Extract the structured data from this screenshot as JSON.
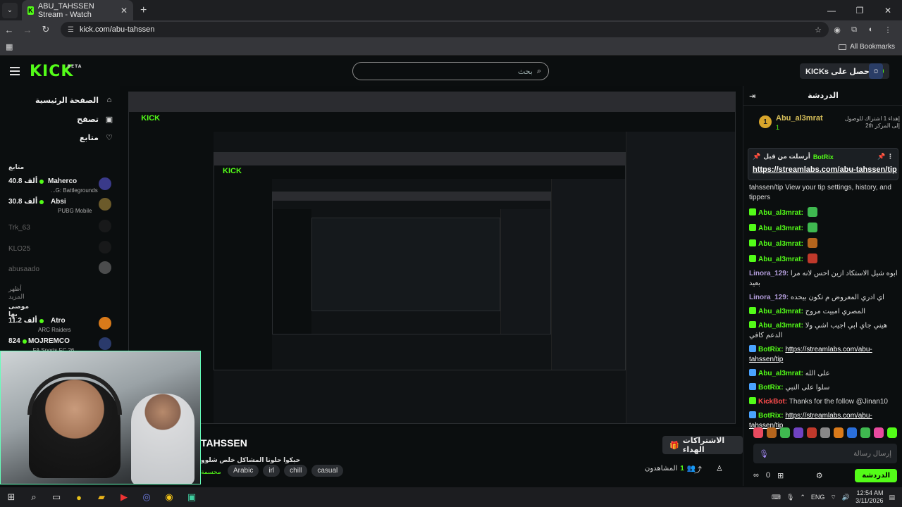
{
  "browser": {
    "tab_title": "ABU_TAHSSEN Stream - Watch",
    "url": "kick.com/abu-tahssen",
    "bookmarks_label": "All Bookmarks"
  },
  "header": {
    "logo": "KICK",
    "logo_sup": "BETA",
    "search_placeholder": "بحث",
    "get_kicks": "احصل على KICKs"
  },
  "sidebar": {
    "nav": [
      {
        "label": "الصفحة الرئيسية",
        "icon": "home-icon",
        "glyph": "⌂"
      },
      {
        "label": "تصفح",
        "icon": "browse-icon",
        "glyph": "▣"
      },
      {
        "label": "متابع",
        "icon": "heart-icon",
        "glyph": "♡"
      }
    ],
    "following_header": "متابع",
    "following": [
      {
        "name": "Maherco",
        "game": "...G: Battlegrounds",
        "viewers": "40.8 ألف",
        "live": true,
        "color": "#3a3a8a"
      },
      {
        "name": "Absi",
        "game": "PUBG Mobile",
        "viewers": "30.8 ألف",
        "live": true,
        "color": "#6b5a2a"
      },
      {
        "name": "Trk_63",
        "game": "",
        "viewers": "",
        "live": false,
        "color": "#333"
      },
      {
        "name": "KLO25",
        "game": "",
        "viewers": "",
        "live": false,
        "color": "#333"
      },
      {
        "name": "abusaado",
        "game": "",
        "viewers": "",
        "live": false,
        "color": "#666"
      }
    ],
    "show_more": "أظهر المزيد",
    "recommended_header": "موصى بها",
    "recommended": [
      {
        "name": "Atro",
        "game": "ARC Raiders",
        "viewers": "11.2 ألف",
        "color": "#d97a1a"
      },
      {
        "name": "MOJREMCO",
        "game": "...FA Sports FC 26",
        "viewers": "824",
        "color": "#2a3a6b"
      }
    ]
  },
  "stream": {
    "name": "TAHSSEN",
    "title": "حيكوا حلونا المشاكل خلص شلوو",
    "category": "محسمة",
    "tags": [
      "Arabic",
      "irl",
      "chill",
      "casual"
    ],
    "subs_button": "الاشتراكات الهداء",
    "viewers_label": "المشاهدون",
    "viewers_count": "1"
  },
  "chat": {
    "title": "الدردشة",
    "top_gifter": {
      "rank": "1",
      "name": "Abu_al3mrat",
      "count": "1",
      "note": "إهداء 1 اشتراك للوصول إلى المركز 2th"
    },
    "pinned": {
      "by": "أرسلت من قبل",
      "user": "BotRix",
      "link": "https://streamlabs.com/abu-tahssen/tip"
    },
    "messages": [
      {
        "user": "",
        "text": "tahssen/tip View your tip settings, history, and tippers",
        "color": "#ddd",
        "badge": ""
      },
      {
        "user": "Abu_al3mrat:",
        "text": "",
        "color": "#53fc18",
        "badge": "#53fc18",
        "emote": "#3fb950"
      },
      {
        "user": "Abu_al3mrat:",
        "text": "",
        "color": "#53fc18",
        "badge": "#53fc18",
        "emote": "#3fb950"
      },
      {
        "user": "Abu_al3mrat:",
        "text": "",
        "color": "#53fc18",
        "badge": "#53fc18",
        "emote": "#b5651d"
      },
      {
        "user": "Abu_al3mrat:",
        "text": "",
        "color": "#53fc18",
        "badge": "#53fc18",
        "emote": "#c0392b"
      },
      {
        "user": "Linora_129:",
        "text": "ابوه شيل الاستكاد ازين احس لانه مرا بعيد",
        "color": "#b39ddb",
        "badge": ""
      },
      {
        "user": "Linora_129:",
        "text": "اي ادري المعروض م تكون بيحده",
        "color": "#b39ddb",
        "badge": ""
      },
      {
        "user": "Abu_al3mrat:",
        "text": "المصري امبيت مروح",
        "color": "#53fc18",
        "badge": "#53fc18"
      },
      {
        "user": "Abu_al3mrat:",
        "text": "هيني جاي ابي اجيب اشي ولا الدعم كافي",
        "color": "#53fc18",
        "badge": "#53fc18"
      },
      {
        "user": "BotRix:",
        "text": "https://streamlabs.com/abu-tahssen/tip",
        "color": "#53fc18",
        "badge": "#4aa3ff",
        "link": true
      },
      {
        "user": "Abu_al3mrat:",
        "text": "على الله",
        "color": "#53fc18",
        "badge": "#4aa3ff"
      },
      {
        "user": "BotRix:",
        "text": "سلوا على النبي",
        "color": "#53fc18",
        "badge": "#4aa3ff"
      },
      {
        "user": "KickBot:",
        "text": "Thanks for the follow @Jinan10",
        "color": "#ff4d4d",
        "badge": "#53fc18"
      },
      {
        "user": "BotRix:",
        "text": "https://streamlabs.com/abu-tahssen/tip",
        "color": "#53fc18",
        "badge": "#4aa3ff",
        "link": true
      }
    ],
    "input_placeholder": "إرسال رسالة",
    "points": "0",
    "send_label": "الدردشة"
  },
  "taskbar": {
    "time": "12:54 AM",
    "date": "3/11/2026",
    "lang": "ENG"
  }
}
